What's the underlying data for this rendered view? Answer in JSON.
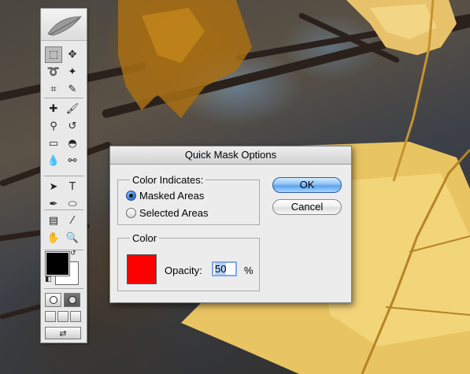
{
  "dialog": {
    "title": "Quick Mask Options",
    "color_indicates": {
      "label": "Color Indicates:",
      "options": [
        {
          "label": "Masked Areas",
          "selected": true
        },
        {
          "label": "Selected Areas",
          "selected": false
        }
      ]
    },
    "color_group": {
      "label": "Color",
      "swatch_color": "#ff0000",
      "opacity_label": "Opacity:",
      "opacity_value": "50",
      "opacity_unit": "%"
    },
    "ok_label": "OK",
    "cancel_label": "Cancel"
  },
  "toolbox": {
    "tools": [
      {
        "name": "rectangular-marquee-icon",
        "glyph": "⬚",
        "selected": true
      },
      {
        "name": "move-icon",
        "glyph": "✥"
      },
      {
        "name": "lasso-icon",
        "glyph": "➰"
      },
      {
        "name": "magic-wand-icon",
        "glyph": "✦"
      },
      {
        "name": "crop-icon",
        "glyph": "⌗"
      },
      {
        "name": "slice-icon",
        "glyph": "✎"
      },
      {
        "name": "healing-brush-icon",
        "glyph": "✚"
      },
      {
        "name": "brush-icon",
        "glyph": "🖌"
      },
      {
        "name": "clone-stamp-icon",
        "glyph": "⚲"
      },
      {
        "name": "history-brush-icon",
        "glyph": "↺"
      },
      {
        "name": "eraser-icon",
        "glyph": "▭"
      },
      {
        "name": "paint-bucket-icon",
        "glyph": "◓"
      },
      {
        "name": "blur-icon",
        "glyph": "💧"
      },
      {
        "name": "dodge-icon",
        "glyph": "⚯"
      },
      {
        "name": "path-selection-icon",
        "glyph": "➤"
      },
      {
        "name": "type-icon",
        "glyph": "T"
      },
      {
        "name": "pen-icon",
        "glyph": "✒"
      },
      {
        "name": "shape-icon",
        "glyph": "⬭"
      },
      {
        "name": "notes-icon",
        "glyph": "▤"
      },
      {
        "name": "eyedropper-icon",
        "glyph": "⁄"
      },
      {
        "name": "hand-icon",
        "glyph": "✋"
      },
      {
        "name": "zoom-icon",
        "glyph": "🔍"
      }
    ],
    "foreground_color": "#000000",
    "background_color": "#ffffff",
    "swap_glyph": "↺",
    "default_glyph": "◧",
    "quick_mask_mode": true
  }
}
